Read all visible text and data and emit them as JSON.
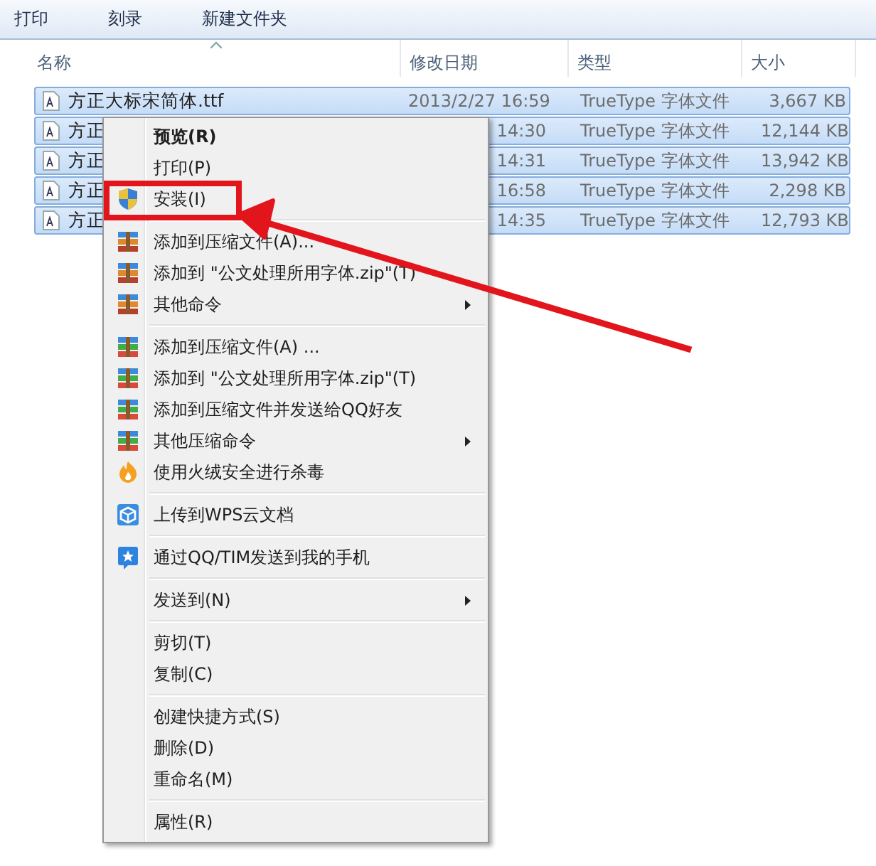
{
  "toolbar": {
    "buttons": [
      "打印",
      "刻录",
      "新建文件夹"
    ]
  },
  "columns": [
    "名称",
    "修改日期",
    "类型",
    "大小"
  ],
  "rows": [
    {
      "name": "方正大标宋简体.ttf",
      "date": "2013/2/27 16:59",
      "type": "TrueType 字体文件",
      "size": "3,667 KB",
      "selected": true
    },
    {
      "name": "方正",
      "date": "14:30",
      "type": "TrueType 字体文件",
      "size": "12,144 KB",
      "selected": true
    },
    {
      "name": "方正",
      "date": "14:31",
      "type": "TrueType 字体文件",
      "size": "13,942 KB",
      "selected": true
    },
    {
      "name": "方正",
      "date": "16:58",
      "type": "TrueType 字体文件",
      "size": "2,298 KB",
      "selected": true
    },
    {
      "name": "方正",
      "date": "14:35",
      "type": "TrueType 字体文件",
      "size": "12,793 KB",
      "selected": true
    }
  ],
  "context_menu": {
    "groups": [
      [
        {
          "label": "预览(R)",
          "default": true
        },
        {
          "label": "打印(P)"
        },
        {
          "label": "安装(I)",
          "kind": "shield",
          "highlighted": true
        }
      ],
      [
        {
          "label": "添加到压缩文件(A)...",
          "kind": "archive"
        },
        {
          "label": "添加到 \"公文处理所用字体.zip\"(T)",
          "kind": "archive"
        },
        {
          "label": "其他命令",
          "kind": "archive",
          "submenu": true
        }
      ],
      [
        {
          "label": "添加到压缩文件(A) ...",
          "kind": "archive2"
        },
        {
          "label": "添加到 \"公文处理所用字体.zip\"(T)",
          "kind": "archive2"
        },
        {
          "label": "添加到压缩文件并发送给QQ好友",
          "kind": "archive2"
        },
        {
          "label": "其他压缩命令",
          "kind": "archive2",
          "submenu": true
        },
        {
          "label": "使用火绒安全进行杀毒",
          "kind": "flame"
        }
      ],
      [
        {
          "label": "上传到WPS云文档",
          "kind": "cube"
        }
      ],
      [
        {
          "label": "通过QQ/TIM发送到我的手机",
          "kind": "star"
        }
      ],
      [
        {
          "label": "发送到(N)",
          "submenu": true
        }
      ],
      [
        {
          "label": "剪切(T)"
        },
        {
          "label": "复制(C)"
        }
      ],
      [
        {
          "label": "创建快捷方式(S)"
        },
        {
          "label": "删除(D)"
        },
        {
          "label": "重命名(M)"
        }
      ],
      [
        {
          "label": "属性(R)"
        }
      ]
    ]
  }
}
